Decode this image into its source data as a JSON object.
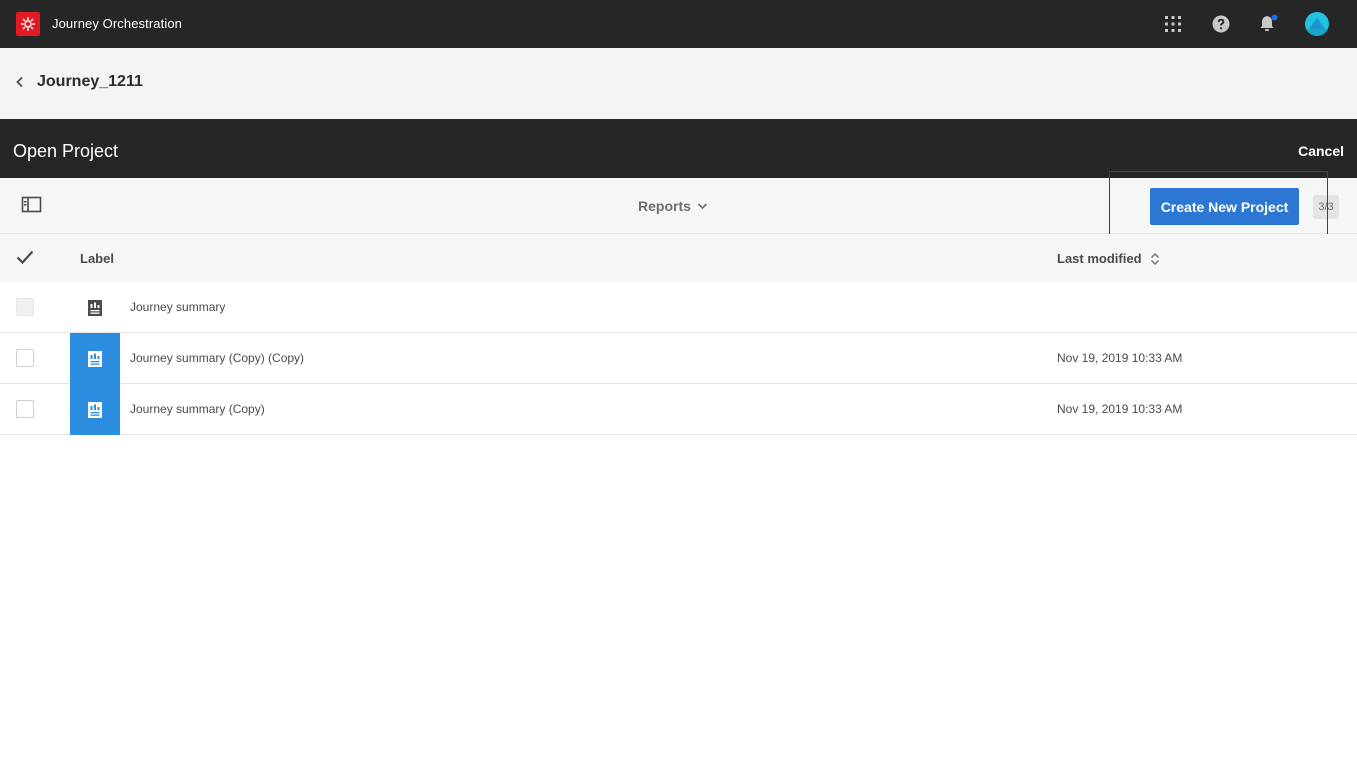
{
  "app": {
    "title": "Journey Orchestration",
    "logo_icon": "adobe-journey-logo",
    "accent_color": "#e21a23"
  },
  "header_icons": [
    "apps-grid-icon",
    "help-icon",
    "notification-bell-icon",
    "user-avatar"
  ],
  "breadcrumb": {
    "back_icon": "chevron-left-icon",
    "title": "Journey_1211"
  },
  "dialog": {
    "title": "Open Project",
    "cancel_label": "Cancel"
  },
  "toolbar": {
    "rail_icon": "rail-toggle-icon",
    "filter_label": "Reports",
    "create_label": "Create New Project",
    "count": "3/3",
    "primary_color": "#2c77d4"
  },
  "table": {
    "columns": {
      "label": "Label",
      "modified": "Last modified"
    },
    "rows": [
      {
        "label": "Journey summary",
        "modified": "",
        "selected": false,
        "disabled": true
      },
      {
        "label": "Journey summary (Copy) (Copy)",
        "modified": "Nov 19, 2019 10:33 AM",
        "selected": true,
        "disabled": false
      },
      {
        "label": "Journey summary (Copy)",
        "modified": "Nov 19, 2019 10:33 AM",
        "selected": true,
        "disabled": false
      }
    ]
  }
}
